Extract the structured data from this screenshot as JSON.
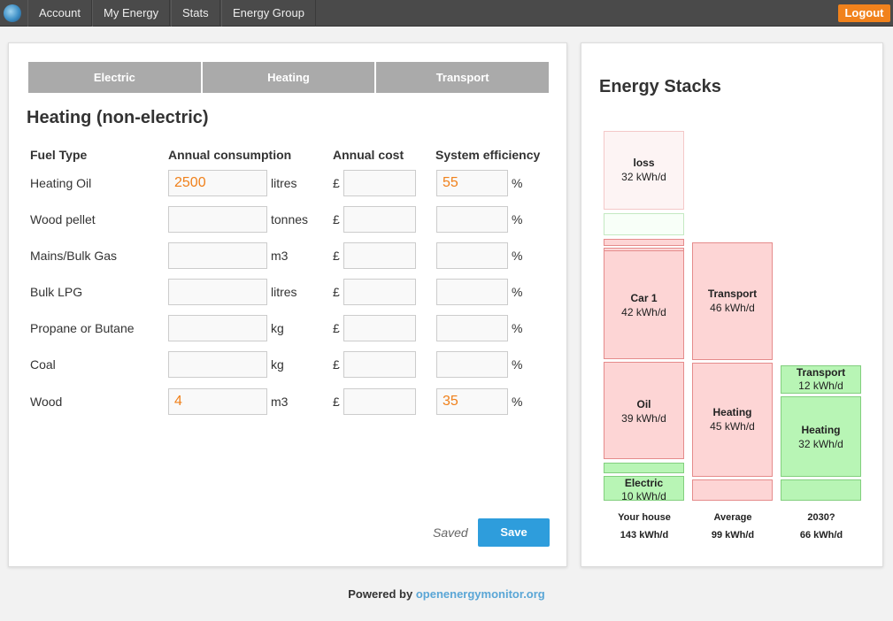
{
  "nav": {
    "items": [
      "Account",
      "My Energy",
      "Stats",
      "Energy Group"
    ],
    "logout": "Logout"
  },
  "tabs": [
    "Electric",
    "Heating",
    "Transport"
  ],
  "section_title": "Heating (non-electric)",
  "headers": {
    "fuel": "Fuel Type",
    "consumption": "Annual consumption",
    "cost": "Annual cost",
    "efficiency": "System efficiency"
  },
  "rows": [
    {
      "fuel": "Heating Oil",
      "consumption": "2500",
      "unit": "litres",
      "currency": "£",
      "cost": "",
      "efficiency": "55",
      "pct": "%"
    },
    {
      "fuel": "Wood pellet",
      "consumption": "",
      "unit": "tonnes",
      "currency": "£",
      "cost": "",
      "efficiency": "",
      "pct": "%"
    },
    {
      "fuel": "Mains/Bulk Gas",
      "consumption": "",
      "unit": "m3",
      "currency": "£",
      "cost": "",
      "efficiency": "",
      "pct": "%"
    },
    {
      "fuel": "Bulk LPG",
      "consumption": "",
      "unit": "litres",
      "currency": "£",
      "cost": "",
      "efficiency": "",
      "pct": "%"
    },
    {
      "fuel": "Propane or Butane",
      "consumption": "",
      "unit": "kg",
      "currency": "£",
      "cost": "",
      "efficiency": "",
      "pct": "%"
    },
    {
      "fuel": "Coal",
      "consumption": "",
      "unit": "kg",
      "currency": "£",
      "cost": "",
      "efficiency": "",
      "pct": "%"
    },
    {
      "fuel": "Wood",
      "consumption": "4",
      "unit": "m3",
      "currency": "£",
      "cost": "",
      "efficiency": "35",
      "pct": "%"
    }
  ],
  "status": "Saved",
  "save_label": "Save",
  "stacks": {
    "title": "Energy Stacks",
    "blocks": {
      "loss": {
        "name": "loss",
        "value": "32 kWh/d"
      },
      "car1": {
        "name": "Car 1",
        "value": "42 kWh/d"
      },
      "oil": {
        "name": "Oil",
        "value": "39 kWh/d"
      },
      "electric": {
        "name": "Electric",
        "value": "10 kWh/d"
      },
      "avg_transport": {
        "name": "Transport",
        "value": "46 kWh/d"
      },
      "avg_heating": {
        "name": "Heating",
        "value": "45 kWh/d"
      },
      "t2030_transport": {
        "name": "Transport",
        "value": "12 kWh/d"
      },
      "t2030_heating": {
        "name": "Heating",
        "value": "32 kWh/d"
      }
    },
    "columns": [
      {
        "label": "Your house",
        "total": "143 kWh/d"
      },
      {
        "label": "Average",
        "total": "99 kWh/d"
      },
      {
        "label": "2030?",
        "total": "66 kWh/d"
      }
    ]
  },
  "footer": {
    "prefix": "Powered by",
    "link": "openenergymonitor.org"
  },
  "colors": {
    "accent_orange": "#f1821c",
    "save_blue": "#2e9ddc",
    "block_red": "#fdd5d5",
    "block_green": "#b8f5b5"
  }
}
